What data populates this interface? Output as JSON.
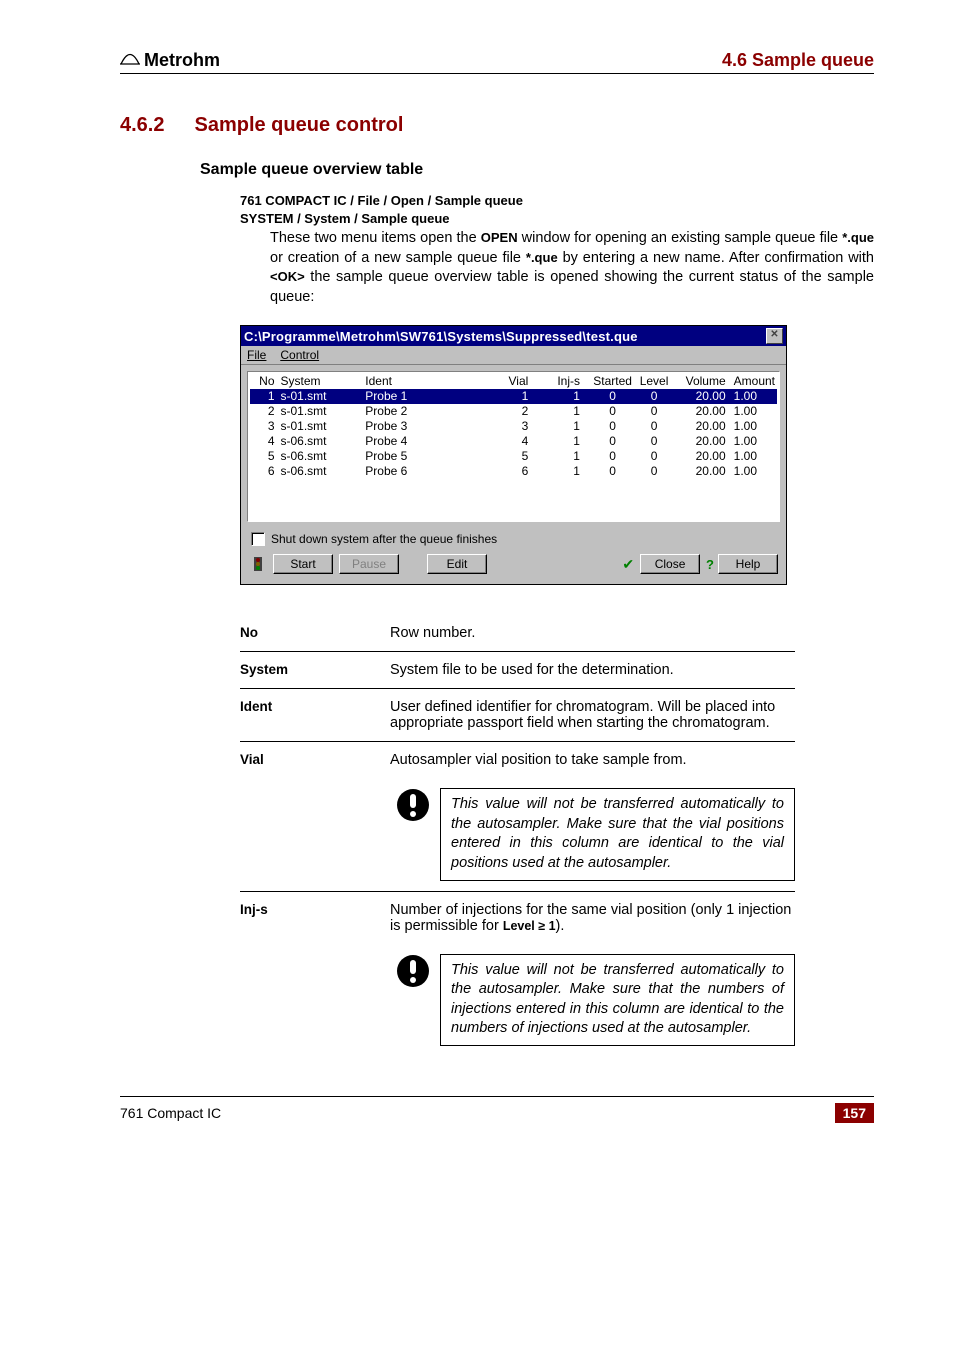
{
  "header": {
    "brand": "Metrohm",
    "section_ref": "4.6  Sample queue"
  },
  "section": {
    "number": "4.6.2",
    "title": "Sample queue control",
    "sub_heading": "Sample queue overview table",
    "path1": "761 COMPACT IC / File / Open / Sample queue",
    "path2": "SYSTEM / System / Sample queue",
    "intro_a": "These two menu items open the ",
    "intro_b": "OPEN",
    "intro_c": " window for opening an existing sample queue file ",
    "intro_d": "*.que",
    "intro_e": " or creation of a new sample queue file ",
    "intro_f": "*.que",
    "intro_g": " by entering a new name. After confirmation with ",
    "intro_h": "<OK>",
    "intro_i": " the sample queue overview table is opened showing the current status of the sample queue:"
  },
  "window": {
    "title": "C:\\Programme\\Metrohm\\SW761\\Systems\\Suppressed\\test.que",
    "menu": {
      "file": "File",
      "control": "Control"
    },
    "headers": {
      "no": "No",
      "system": "System",
      "ident": "Ident",
      "vial": "Vial",
      "injs": "Inj-s",
      "started": "Started",
      "level": "Level",
      "volume": "Volume",
      "amount": "Amount"
    },
    "rows": [
      {
        "no": "1",
        "system": "s-01.smt",
        "ident": "Probe 1",
        "vial": "1",
        "injs": "1",
        "started": "0",
        "level": "0",
        "volume": "20.00",
        "amount": "1.00"
      },
      {
        "no": "2",
        "system": "s-01.smt",
        "ident": "Probe 2",
        "vial": "2",
        "injs": "1",
        "started": "0",
        "level": "0",
        "volume": "20.00",
        "amount": "1.00"
      },
      {
        "no": "3",
        "system": "s-01.smt",
        "ident": "Probe 3",
        "vial": "3",
        "injs": "1",
        "started": "0",
        "level": "0",
        "volume": "20.00",
        "amount": "1.00"
      },
      {
        "no": "4",
        "system": "s-06.smt",
        "ident": "Probe 4",
        "vial": "4",
        "injs": "1",
        "started": "0",
        "level": "0",
        "volume": "20.00",
        "amount": "1.00"
      },
      {
        "no": "5",
        "system": "s-06.smt",
        "ident": "Probe 5",
        "vial": "5",
        "injs": "1",
        "started": "0",
        "level": "0",
        "volume": "20.00",
        "amount": "1.00"
      },
      {
        "no": "6",
        "system": "s-06.smt",
        "ident": "Probe 6",
        "vial": "6",
        "injs": "1",
        "started": "0",
        "level": "0",
        "volume": "20.00",
        "amount": "1.00"
      }
    ],
    "checkbox": "Shut down system after the queue finishes",
    "buttons": {
      "start": "Start",
      "pause": "Pause",
      "edit": "Edit",
      "close": "Close",
      "help": "Help"
    }
  },
  "defs": {
    "no": {
      "term": "No",
      "desc": "Row number."
    },
    "system": {
      "term": "System",
      "desc": "System file to be used for the determination."
    },
    "ident": {
      "term": "Ident",
      "desc": "User defined identifier for chromatogram. Will be placed into appropriate passport field when starting the chromatogram."
    },
    "vial": {
      "term": "Vial",
      "desc": "Autosampler vial position to take sample from."
    },
    "vial_note": "This value will not be transferred automatically to the autosampler. Make sure that the vial positions entered in this column are identical to the vial positions used at the autosampler.",
    "injs": {
      "term": "Inj-s",
      "desc_a": "Number of injections for the same vial position (only 1 injection is permissible for ",
      "desc_b": "Level ≥ 1",
      "desc_c": ")."
    },
    "injs_note": "This value will not be transferred automatically to the autosampler. Make sure that the numbers of injections entered in this column are identical to the numbers of injections used at the autosampler."
  },
  "footer": {
    "left": "761 Compact IC",
    "right": "157"
  }
}
